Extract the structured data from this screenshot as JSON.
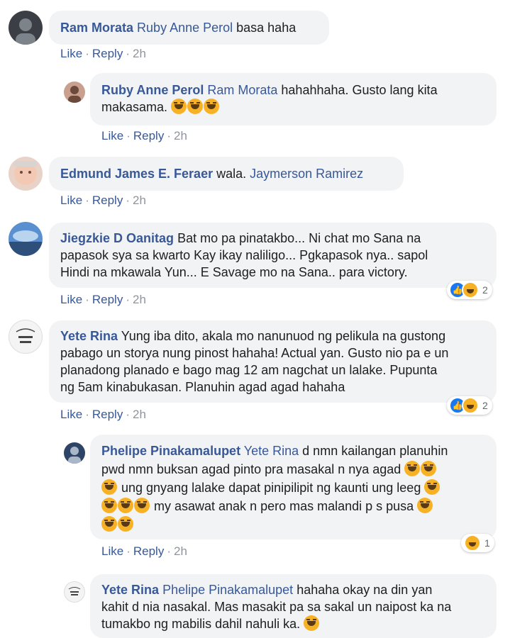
{
  "actions": {
    "like": "Like",
    "reply": "Reply"
  },
  "comments": [
    {
      "author": "Ram Morata",
      "mention": "Ruby Anne Perol",
      "text": " basa haha",
      "time": "2h"
    },
    {
      "author": "Ruby Anne Perol",
      "mention": "Ram Morata",
      "line1": " hahahhaha. Gusto lang kita",
      "line2": "makasama.",
      "time": "2h"
    },
    {
      "author": "Edmund James E. Feraer",
      "text": " wala. ",
      "mention": "Jaymerson Ramirez",
      "time": "2h"
    },
    {
      "author": "Jiegzkie D Oanitag",
      "line1": " Bat mo pa pinatakbo... Ni chat mo Sana na",
      "line2": "papasok sya sa kwarto Kay ikay naliligo... Pgkapasok nya.. sapol",
      "line3": "Hindi na mkawala Yun... E Savage mo na Sana.. para victory.",
      "time": "2h",
      "reactions": "2"
    },
    {
      "author": "Yete Rina",
      "line1": " Yung iba dito, akala mo nanunuod ng pelikula na gustong",
      "line2": "pabago un storya nung pinost hahaha! Actual yan. Gusto nio pa e un",
      "line3": "planadong planado e bago mag 12 am nagchat un lalake. Pupunta",
      "line4": "ng 5am kinabukasan. Planuhin agad agad hahaha",
      "time": "2h",
      "reactions": "2"
    },
    {
      "author": "Phelipe Pinakamalupet",
      "mention": "Yete Rina",
      "line1": " d nmn kailangan planuhin",
      "line2": "pwd nmn buksan agad pinto pra masakal n nya agad",
      "line3": " ung gnyang lalake dapat pinipilipit ng kaunti ung leeg",
      "line4": " my asawat anak n pero mas malandi p s pusa",
      "time": "2h",
      "reactions": "1"
    },
    {
      "author": "Yete Rina",
      "mention": "Phelipe Pinakamalupet",
      "line1": " hahaha okay na din yan",
      "line2": "kahit d nia nasakal. Mas masakit pa sa sakal un naipost ka na",
      "line3": "tumakbo ng mabilis dahil nahuli ka."
    }
  ],
  "colors": {
    "link": "#385898",
    "bubble": "#f2f3f5",
    "meta": "#90949c"
  }
}
